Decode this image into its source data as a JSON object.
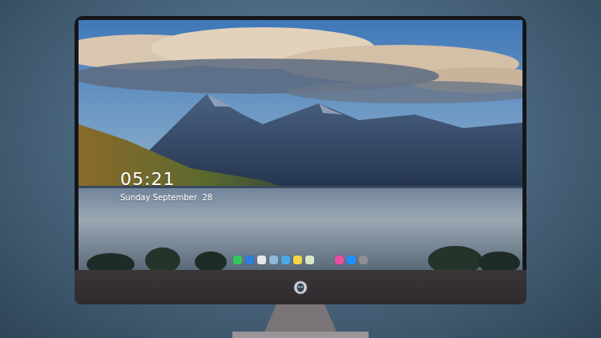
{
  "desktop": {
    "time": "05:21",
    "date": "Sunday September  28"
  },
  "dock": {
    "apps": [
      {
        "color": "#34c759"
      },
      {
        "color": "#2f7de1"
      },
      {
        "color": "#e8e8ea"
      },
      {
        "color": "#8fb8d8"
      },
      {
        "color": "#4aa8e8"
      },
      {
        "color": "#f5d547"
      },
      {
        "color": "#d9e6c9"
      },
      {
        "color": "#e84fa0"
      },
      {
        "color": "#1e90ff"
      },
      {
        "color": "#8e8e93"
      }
    ]
  }
}
